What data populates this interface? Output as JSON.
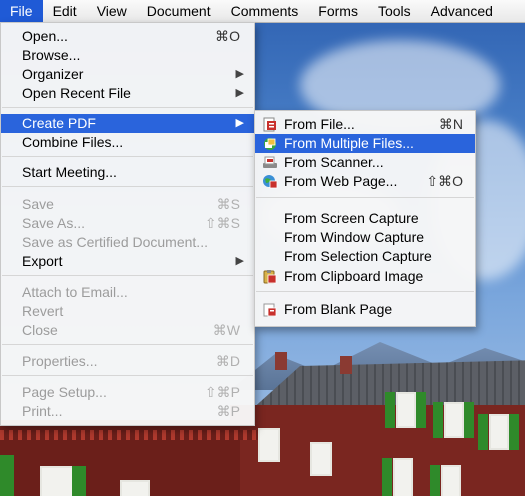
{
  "menubar": {
    "items": [
      {
        "label": "File"
      },
      {
        "label": "Edit"
      },
      {
        "label": "View"
      },
      {
        "label": "Document"
      },
      {
        "label": "Comments"
      },
      {
        "label": "Forms"
      },
      {
        "label": "Tools"
      },
      {
        "label": "Advanced"
      }
    ]
  },
  "file_menu": {
    "open": {
      "label": "Open...",
      "shortcut": "⌘O"
    },
    "browse": {
      "label": "Browse..."
    },
    "organizer": {
      "label": "Organizer"
    },
    "open_recent": {
      "label": "Open Recent File"
    },
    "create_pdf": {
      "label": "Create PDF"
    },
    "combine_files": {
      "label": "Combine Files..."
    },
    "start_meeting": {
      "label": "Start Meeting..."
    },
    "save": {
      "label": "Save",
      "shortcut": "⌘S"
    },
    "save_as": {
      "label": "Save As...",
      "shortcut": "⇧⌘S"
    },
    "save_certified": {
      "label": "Save as Certified Document..."
    },
    "export": {
      "label": "Export"
    },
    "attach_email": {
      "label": "Attach to Email..."
    },
    "revert": {
      "label": "Revert"
    },
    "close": {
      "label": "Close",
      "shortcut": "⌘W"
    },
    "properties": {
      "label": "Properties...",
      "shortcut": "⌘D"
    },
    "page_setup": {
      "label": "Page Setup...",
      "shortcut": "⇧⌘P"
    },
    "print": {
      "label": "Print...",
      "shortcut": "⌘P"
    }
  },
  "submenu": {
    "from_file": {
      "label": "From File...",
      "shortcut": "⌘N"
    },
    "from_multiple": {
      "label": "From Multiple Files..."
    },
    "from_scanner": {
      "label": "From Scanner..."
    },
    "from_web": {
      "label": "From Web Page...",
      "shortcut": "⇧⌘O"
    },
    "from_screen": {
      "label": "From Screen Capture"
    },
    "from_window": {
      "label": "From Window Capture"
    },
    "from_selection": {
      "label": "From Selection Capture"
    },
    "from_clipboard": {
      "label": "From Clipboard Image"
    },
    "from_blank": {
      "label": "From Blank Page"
    }
  },
  "colors": {
    "highlight": "#2a64dc",
    "disabled_text": "#9c9c9c"
  }
}
